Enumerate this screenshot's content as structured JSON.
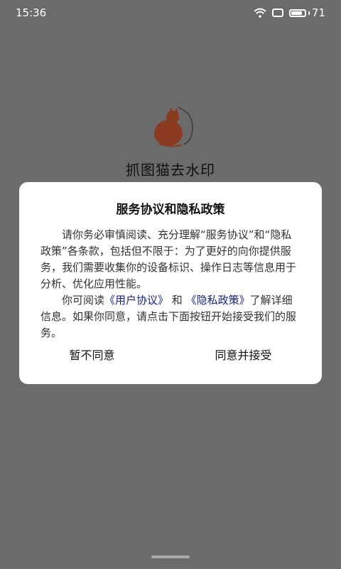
{
  "status_bar": {
    "time": "15:36",
    "battery_level": "71",
    "icons": [
      "wifi-icon",
      "screen-icon",
      "battery-icon"
    ]
  },
  "app": {
    "name": "抓图猫去水印",
    "logo_color": "#8a3a1f"
  },
  "dialog": {
    "title": "服务协议和隐私政策",
    "paragraph1": "请你务必审慎阅读、充分理解“服务协议”和“隐私政策”各条款，包括但不限于：为了更好的向你提供服务，我们需要收集你的设备标识、操作日志等信息用于分析、优化应用性能。",
    "paragraph2_prefix": "你可阅读",
    "user_agreement_link": "《用户协议》",
    "and_text": " 和 ",
    "privacy_policy_link": "《隐私政策》",
    "paragraph2_suffix": "了解详细信息。如果你同意，请点击下面按钮开始接受我们的服务。",
    "decline_button": "暂不同意",
    "accept_button": "同意并接受"
  }
}
